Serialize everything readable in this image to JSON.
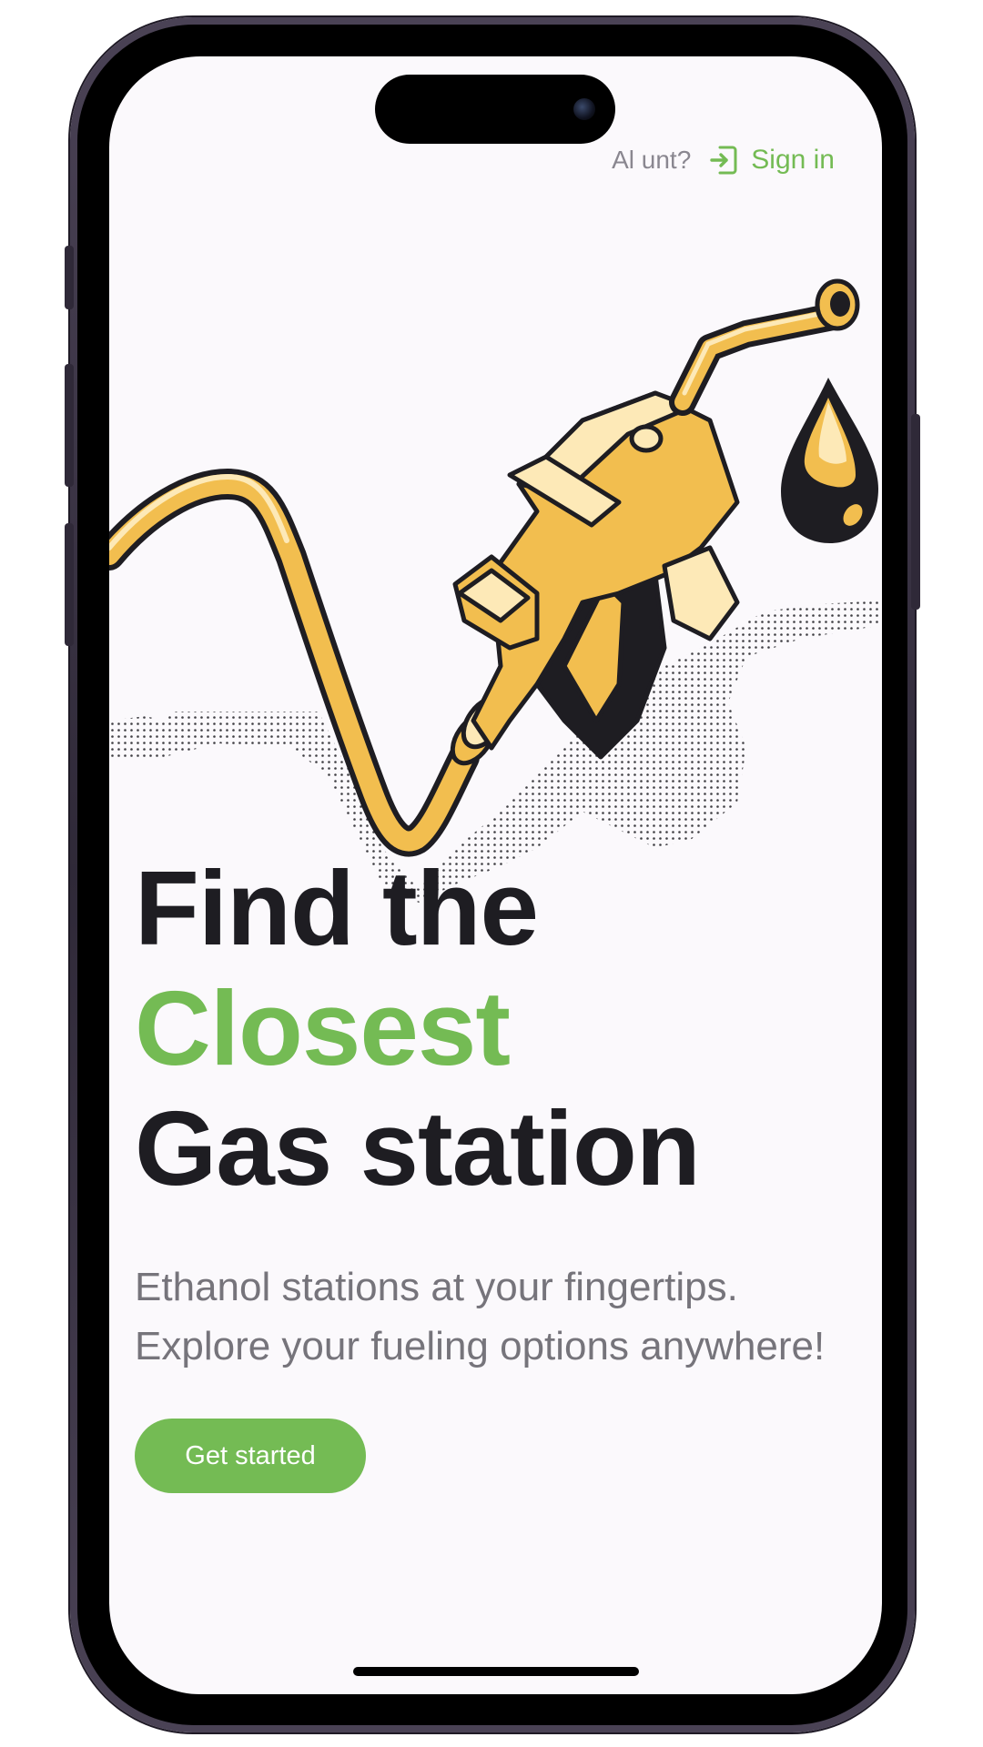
{
  "topbar": {
    "prompt_visible": "Al                    unt?",
    "signin_label": "Sign in"
  },
  "headline": {
    "line1": "Find the",
    "line2": "Closest",
    "line3": "Gas station"
  },
  "subtitle": "Ethanol stations at your fingertips. Explore your fueling options anywhere!",
  "cta": {
    "label": "Get started"
  },
  "colors": {
    "accent": "#74bb54",
    "text": "#1e1d22",
    "muted": "#76747b",
    "background": "#fbf9fc",
    "illustration_yellow": "#f2be4f"
  },
  "icons": {
    "signin": "sign-in-icon",
    "illustration": "fuel-nozzle-illustration",
    "drop": "fuel-drop-icon"
  }
}
